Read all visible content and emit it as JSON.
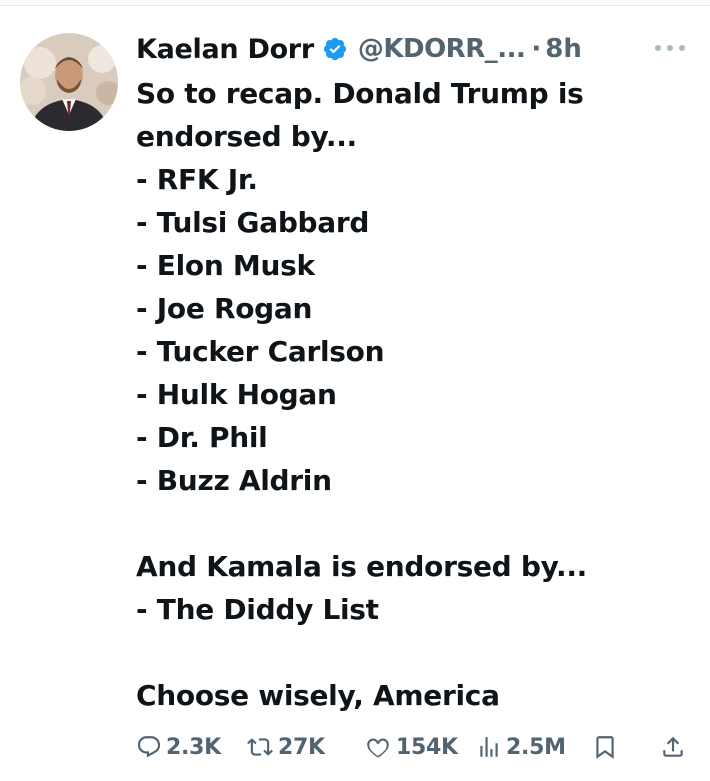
{
  "tweet": {
    "author": {
      "display_name": "Kaelan Dorr",
      "handle": "@KDORR_...",
      "separator": "·",
      "time": "8h",
      "verified": true
    },
    "text": {
      "intro_lines": [
        "So to recap. Donald Trump is",
        "endorsed by..."
      ],
      "trump_endorsers": [
        "- RFK Jr.",
        "- Tulsi Gabbard",
        "- Elon Musk",
        "- Joe Rogan",
        "- Tucker Carlson",
        "- Hulk Hogan",
        "- Dr. Phil",
        "- Buzz Aldrin"
      ],
      "kamala_intro": "And Kamala is endorsed by...",
      "kamala_endorsers": [
        "-  The Diddy List"
      ],
      "closing": "Choose wisely, America"
    },
    "metrics": {
      "replies": "2.3K",
      "reposts": "27K",
      "likes": "154K",
      "views": "2.5M"
    }
  },
  "icons": {
    "verified": "verified-badge-icon",
    "more": "more-options-icon",
    "reply": "reply-icon",
    "repost": "repost-icon",
    "like": "heart-icon",
    "views": "views-chart-icon",
    "bookmark": "bookmark-icon",
    "share": "share-icon"
  },
  "colors": {
    "text_primary": "#0f1419",
    "text_secondary": "#536471",
    "verified_blue": "#1d9bf0"
  }
}
